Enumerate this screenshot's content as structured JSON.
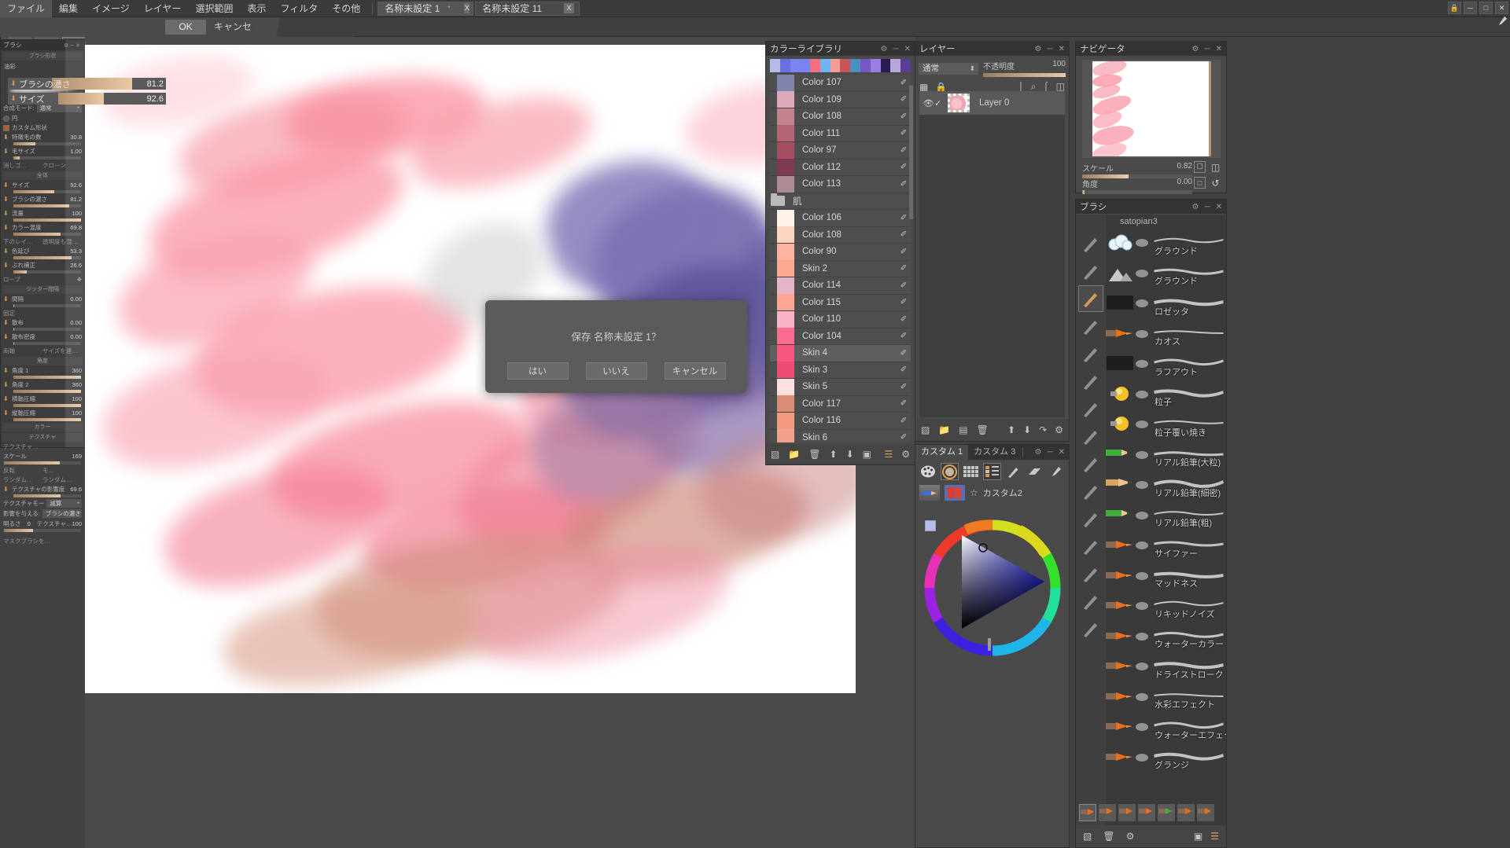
{
  "menubar": {
    "items": [
      "ファイル",
      "編集",
      "イメージ",
      "レイヤー",
      "選択範囲",
      "表示",
      "フィルタ",
      "その他"
    ],
    "tabs": [
      {
        "label": "名称未設定 1",
        "modified": "*",
        "close": "X",
        "active": true
      },
      {
        "label": "名称未設定 11",
        "modified": "",
        "close": "X",
        "active": false
      }
    ],
    "window_controls": [
      "lock-icon",
      "minimize-icon",
      "maximize-icon",
      "close-icon"
    ]
  },
  "optionbar": {
    "ok_label": "OK",
    "cancel_label": "キャンセル"
  },
  "dialog": {
    "message": "保存 名称未設定 1？",
    "yes": "はい",
    "no": "いいえ",
    "cancel": "キャンセル"
  },
  "left_panel": {
    "title": "ブラシ",
    "section_shape": "ブラシ形状",
    "brush_type": "油彩",
    "blend_label": "合成モード:",
    "blend_value": "通常",
    "shape_circle": "円",
    "shape_custom": "カスタム形状",
    "rows_shape": [
      {
        "label": "特徴毛の数",
        "value": "30.8",
        "fill": 32
      },
      {
        "label": "毛サイズ",
        "value": "1.00",
        "fill": 9
      }
    ],
    "eraser": "消しゴ…",
    "clone": "クローン",
    "section_all": "全体",
    "rows_all": [
      {
        "label": "サイズ",
        "value": "92.6",
        "fill": 60
      },
      {
        "label": "ブラシの濃さ",
        "value": "81.2",
        "fill": 82
      },
      {
        "label": "流量",
        "value": "100",
        "fill": 100
      },
      {
        "label": "カラー混度",
        "value": "69.8",
        "fill": 70
      }
    ],
    "under_layer": "下のレイ…",
    "opacity_mix": "透明度も混…",
    "rows_all2": [
      {
        "label": "色延び",
        "value": "53.3",
        "fill": 86
      },
      {
        "label": "ぶれ補正",
        "value": "26.6",
        "fill": 20
      }
    ],
    "rope": "ロープ",
    "section_jitter": "ジッター間隔",
    "rows_jitter": [
      {
        "label": "間隔",
        "value": "0.00",
        "fill": 1
      },
      {
        "label": "散布",
        "value": "0.00",
        "fill": 1
      },
      {
        "label": "散布密度",
        "value": "0.00",
        "fill": 1
      }
    ],
    "fixed": "固定",
    "both_axis": "両軸",
    "size_link": "サイズを連…",
    "section_angle": "角度",
    "rows_angle": [
      {
        "label": "角度 1",
        "value": "360",
        "fill": 100
      },
      {
        "label": "角度 2",
        "value": "360",
        "fill": 100
      },
      {
        "label": "横軸圧縮",
        "value": "100",
        "fill": 100
      },
      {
        "label": "縦軸圧縮",
        "value": "100",
        "fill": 100
      }
    ],
    "section_color": "カラー",
    "section_texture": "テクスチャ",
    "texture_name": "テクスチャ…",
    "texture_scale_label": "スケール",
    "texture_scale_value": "169",
    "flip": "反転",
    "mo": "モ…",
    "random1": "ランダム…",
    "random2": "ランダム…",
    "texture_influence_label": "テクスチャの影響度",
    "texture_influence_value": "69.6",
    "texture_mode_label": "テクスチャモー",
    "texture_mode_value": "減算",
    "affect_label": "影響を与える:",
    "affect_value": "ブラシの濃さ",
    "brightness_label": "明るさ",
    "brightness_value": "0",
    "texture_label2": "テクスチャ…",
    "texture_value2": "100",
    "mask_brush": "マスクブラシを…"
  },
  "color_library": {
    "title": "カラーライブラリ",
    "swatchbar": [
      "#b7bbe8",
      "#6b6fe0",
      "#7d84ef",
      "#7b83ee",
      "#f4707f",
      "#6fb4ee",
      "#f59d95",
      "#c8555b",
      "#4a8fbd",
      "#7558c4",
      "#9b7fe0",
      "#2b1b52",
      "#b5a8d4",
      "#5b3e94"
    ],
    "rows": [
      {
        "name": "Color 107",
        "color": "#8084ac",
        "selected": false,
        "folder": false
      },
      {
        "name": "Color 109",
        "color": "#dda8b9",
        "selected": false,
        "folder": false
      },
      {
        "name": "Color 108",
        "color": "#c2828f",
        "selected": false,
        "folder": false
      },
      {
        "name": "Color 111",
        "color": "#b56476",
        "selected": false,
        "folder": false
      },
      {
        "name": "Color 97",
        "color": "#a44c62",
        "selected": false,
        "folder": false
      },
      {
        "name": "Color 112",
        "color": "#7d3a52",
        "selected": false,
        "folder": false
      },
      {
        "name": "Color 113",
        "color": "#ad8b93",
        "selected": false,
        "folder": false
      },
      {
        "name": "肌",
        "color": "",
        "selected": false,
        "folder": true
      },
      {
        "name": "Color 106",
        "color": "#fdf2e6",
        "selected": false,
        "folder": false
      },
      {
        "name": "Color 108",
        "color": "#fcd5c0",
        "selected": false,
        "folder": false
      },
      {
        "name": "Color 90",
        "color": "#fdb49e",
        "selected": false,
        "folder": false
      },
      {
        "name": "Skin 2",
        "color": "#fba890",
        "selected": false,
        "folder": false
      },
      {
        "name": "Color 114",
        "color": "#e5b4cb",
        "selected": false,
        "folder": false
      },
      {
        "name": "Color 115",
        "color": "#fda693",
        "selected": false,
        "folder": false
      },
      {
        "name": "Color 110",
        "color": "#fbb3c6",
        "selected": false,
        "folder": false
      },
      {
        "name": "Color 104",
        "color": "#f96d93",
        "selected": false,
        "folder": false
      },
      {
        "name": "Skin 4",
        "color": "#f9567f",
        "selected": true,
        "folder": false
      },
      {
        "name": "Skin 3",
        "color": "#ef4a71",
        "selected": false,
        "folder": false
      },
      {
        "name": "Skin 5",
        "color": "#fde0e0",
        "selected": false,
        "folder": false
      },
      {
        "name": "Color 117",
        "color": "#db8e77",
        "selected": false,
        "folder": false
      },
      {
        "name": "Color 116",
        "color": "#f49a7f",
        "selected": false,
        "folder": false
      },
      {
        "name": "Skin 6",
        "color": "#f2a28c",
        "selected": false,
        "folder": false
      }
    ],
    "footer_icons": [
      "new-swatch-icon",
      "folder-icon",
      "trash-icon",
      "move-up-icon",
      "move-down-icon",
      "import-icon",
      "list-view-icon",
      "gear-icon"
    ]
  },
  "layer_panel": {
    "title": "レイヤー",
    "blend_mode": "通常",
    "opacity_label": "不透明度",
    "opacity_value": "100",
    "toolbar_icons": [
      "transparency-lock-icon",
      "lock-icon",
      "align-top-icon",
      "align-center-icon",
      "align-bottom-icon",
      "flip-icon"
    ],
    "layers": [
      {
        "name": "Layer 0",
        "visible": true,
        "checked": true,
        "selected": true
      }
    ],
    "footer_icons": [
      "new-layer-icon",
      "new-folder-icon",
      "duplicate-icon",
      "trash-icon",
      "move-up-icon",
      "move-down-icon",
      "merge-icon",
      "gear-icon"
    ]
  },
  "navigator": {
    "title": "ナビゲータ",
    "scale_label": "スケール",
    "scale_value": "0.82",
    "scale_fill": 42,
    "angle_label": "角度",
    "angle_value": "0.00",
    "angle_fill": 2,
    "buttons": [
      "fit-screen-icon",
      "flip-horizontal-icon",
      "actual-size-icon",
      "reset-rotation-icon"
    ]
  },
  "brush_panel": {
    "title": "ブラシ",
    "set_name": "satopian3",
    "tools": [
      "pen-icon",
      "pencil-icon",
      "oil-brush-icon",
      "blur-icon",
      "eraser-icon",
      "thin-pen-icon",
      "airbrush-icon",
      "marker-icon",
      "pencil2-icon",
      "dip-pen-icon",
      "flat-brush-icon",
      "round-brush-icon",
      "spray-icon",
      "sparkle-icon",
      "calligraphy-icon"
    ],
    "selected_tool_index": 2,
    "brushes": [
      {
        "name": "グラウンド",
        "icon": "cloud-icon"
      },
      {
        "name": "グラウンド",
        "icon": "mountain-icon"
      },
      {
        "name": "ロゼッタ",
        "icon": "dark-bar-icon"
      },
      {
        "name": "カオス",
        "icon": "orange-brush-icon"
      },
      {
        "name": "ラフアウト",
        "icon": "dark-bar-icon"
      },
      {
        "name": "粒子",
        "icon": "bulb-icon"
      },
      {
        "name": "粒子覆い焼き",
        "icon": "bulb-icon"
      },
      {
        "name": "リアル鉛筆(大粒)",
        "icon": "green-pencil-icon"
      },
      {
        "name": "リアル鉛筆(細密)",
        "icon": "pencil-sharp-icon"
      },
      {
        "name": "リアル鉛筆(粗)",
        "icon": "green-pencil-icon"
      },
      {
        "name": "サイファー",
        "icon": "orange-brush-icon"
      },
      {
        "name": "マッドネス",
        "icon": "orange-brush-icon"
      },
      {
        "name": "リキッドノイズ",
        "icon": "orange-brush-icon"
      },
      {
        "name": "ウォーターカラー",
        "icon": "orange-brush-icon"
      },
      {
        "name": "ドライストローク",
        "icon": "orange-brush-icon"
      },
      {
        "name": "水彩エフェクト",
        "icon": "orange-brush-icon"
      },
      {
        "name": "ウォーターエフェクト",
        "icon": "orange-brush-icon"
      },
      {
        "name": "グランジ",
        "icon": "orange-brush-icon"
      }
    ],
    "presets": [
      "brush-a",
      "brush-b",
      "brush-c",
      "brush-d",
      "pencil-green",
      "brush-e",
      "brush-f"
    ],
    "selected_preset_index": 0,
    "footer_icons": [
      "new-brush-icon",
      "trash-icon",
      "gear-icon",
      "thumbnail-view-icon",
      "list-view-icon"
    ]
  },
  "custom1": {
    "tabs": [
      {
        "label": "カスタム 1",
        "active": true
      },
      {
        "label": "カスタム 3",
        "active": false
      }
    ],
    "tools": [
      "palette-icon",
      "color-wheel-icon",
      "grid-swatches-icon",
      "layers-tree-icon",
      "brush-icon",
      "eraser-icon",
      "wrench-icon"
    ],
    "selected_tools": [
      1,
      3
    ],
    "row2_icons": [
      "pencil-swatch-icon",
      "color-pair-icon"
    ],
    "favorite_icon": "star-icon",
    "favorite_label": "カスタム2",
    "foreground_color": "#b7bbe8",
    "wheel_hue_marker": "#2222ee"
  },
  "custom2": {
    "title": "カスタム 2",
    "cells": [
      "blue-pencil",
      "red-flat-brush",
      "orange-fan-brush",
      "flat-brush",
      "fan-brush-wide",
      "tapered-brush",
      "green-blob",
      "green-blob2",
      "orange-brush-sel",
      "spiky-brush",
      "red-roller",
      "dark-fan",
      "orange-bullet",
      "green-bullet",
      "cloud-brush",
      "paper-brush",
      "star-brush",
      "gold-brush"
    ],
    "selected_cell_index": 8,
    "wrench_icon": "wrench-icon",
    "sliders": [
      {
        "label": "ブラシの濃さ",
        "value": "81.2",
        "fill": 82
      },
      {
        "label": "サイズ",
        "value": "92.6",
        "fill": 46
      }
    ]
  }
}
